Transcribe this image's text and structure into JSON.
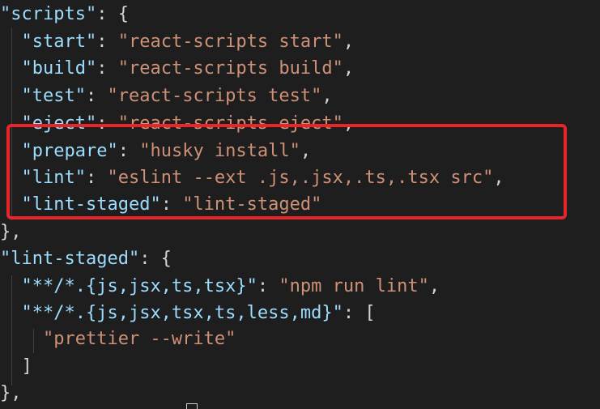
{
  "colors": {
    "background": "#1e1e1e",
    "json_key": "#9cdcfe",
    "json_string": "#ce9178",
    "punctuation": "#d4d4d4",
    "highlight_box": "#e8262a"
  },
  "code": {
    "scripts_key": "\"scripts\"",
    "start_key": "\"start\"",
    "start_value": "\"react-scripts start\"",
    "build_key": "\"build\"",
    "build_value": "\"react-scripts build\"",
    "test_key": "\"test\"",
    "test_value": "\"react-scripts test\"",
    "eject_key": "\"eject\"",
    "eject_value": "\"react-scripts eject\"",
    "prepare_key": "\"prepare\"",
    "prepare_value": "\"husky install\"",
    "lint_key": "\"lint\"",
    "lint_value": "\"eslint --ext .js,.jsx,.ts,.tsx src\"",
    "lint_staged_script_key": "\"lint-staged\"",
    "lint_staged_script_value": "\"lint-staged\"",
    "lint_staged_key": "\"lint-staged\"",
    "pattern1_key": "\"**/*.{js,jsx,ts,tsx}\"",
    "pattern1_value": "\"npm run lint\"",
    "pattern2_key": "\"**/*.{js,jsx,tsx,ts,less,md}\"",
    "pattern2_item": "\"prettier --write\""
  }
}
